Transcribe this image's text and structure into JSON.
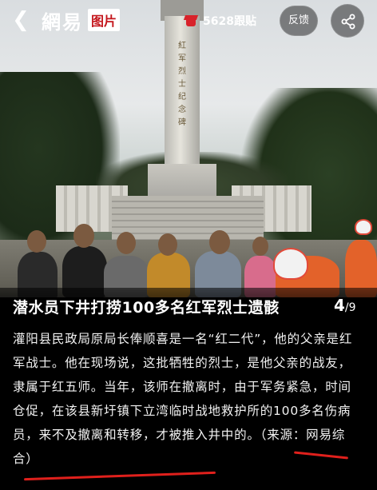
{
  "app": {
    "logo_text": "網易",
    "logo_badge": "图片"
  },
  "header": {
    "follow_count": "5628跟贴",
    "feedback_label": "反馈"
  },
  "photo": {
    "monument_inscription": "紅军烈士纪念碑"
  },
  "caption": {
    "title": "潜水员下井打捞100多名红军烈士遗骸",
    "counter_current": "4",
    "counter_total": "/9",
    "body": "灌阳县民政局原局长俸顺喜是一名“红二代”，他的父亲是红军战士。他在现场说，这批牺牲的烈士，是他父亲的战友，隶属于红五师。当年，该师在撤离时，由于军务紧急，时间仓促，在该县新圩镇下立湾临时战地救护所的100多名伤病员，来不及撤离和转移，才被推入井中的。（来源：网易综合）"
  },
  "colors": {
    "brand_red": "#c4161c",
    "underline_red": "#e0201c"
  },
  "icons": {
    "back": "back-arrow-icon",
    "follow": "comment-cap-icon",
    "share": "share-icon"
  }
}
